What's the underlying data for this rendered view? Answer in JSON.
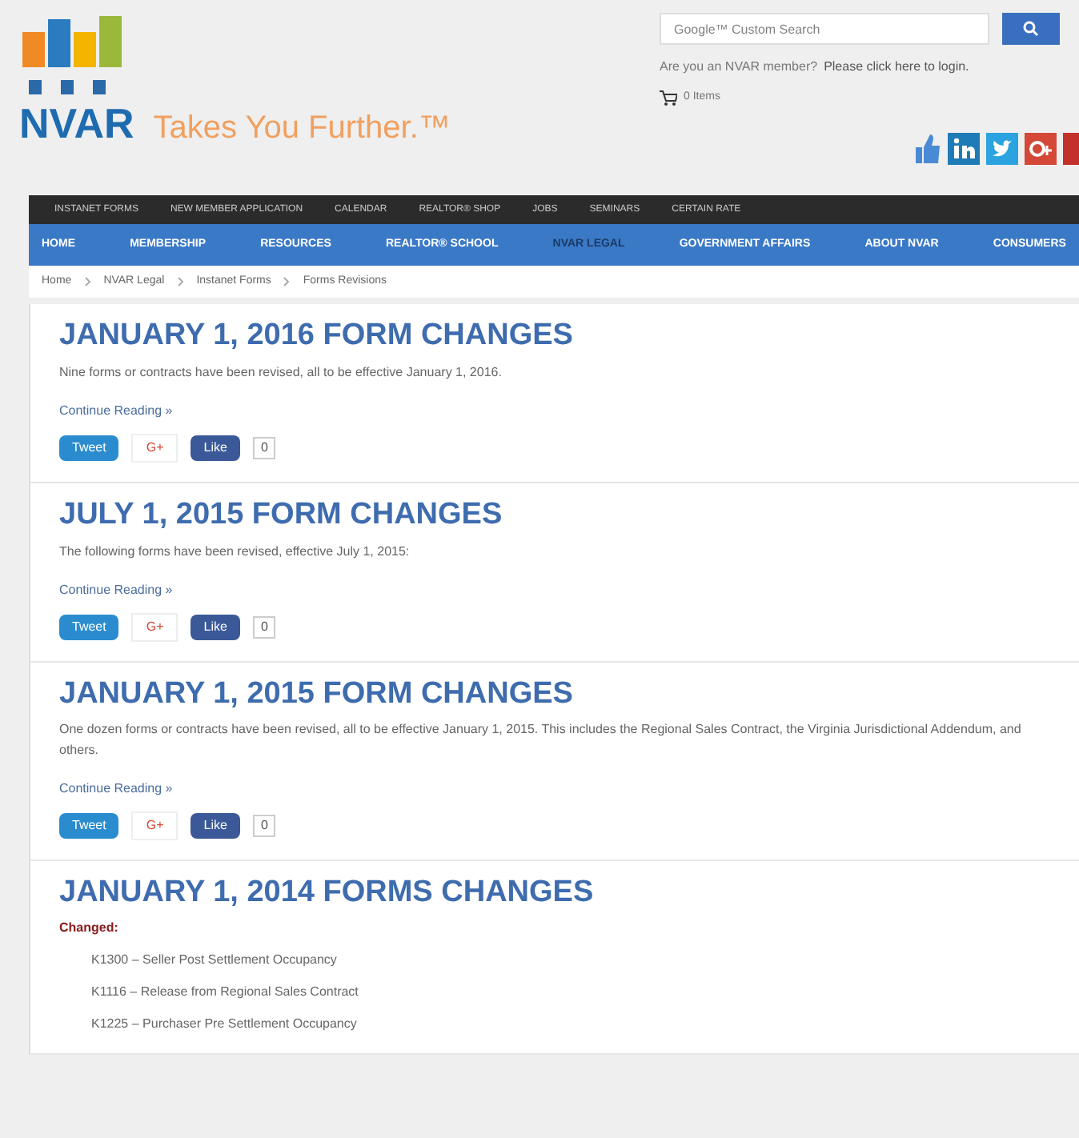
{
  "header": {
    "logo_mark": "NVAR",
    "tagline": "Takes You Further.™",
    "search": {
      "placeholder": "Google™ Custom Search"
    },
    "login_prompt": "Are you an NVAR member?",
    "login_link": "Please click here to login.",
    "cart": "0 Items"
  },
  "top_nav": [
    "INSTANET FORMS",
    "NEW MEMBER APPLICATION",
    "CALENDAR",
    "REALTOR® SHOP",
    "JOBS",
    "SEMINARS",
    "CERTAIN RATE"
  ],
  "main_nav": [
    {
      "label": "HOME",
      "selected": false
    },
    {
      "label": "MEMBERSHIP",
      "selected": false
    },
    {
      "label": "RESOURCES",
      "selected": false
    },
    {
      "label": "REALTOR® SCHOOL",
      "selected": false
    },
    {
      "label": "NVAR LEGAL",
      "selected": true
    },
    {
      "label": "GOVERNMENT AFFAIRS",
      "selected": false
    },
    {
      "label": "ABOUT NVAR",
      "selected": false
    },
    {
      "label": "CONSUMERS",
      "selected": false
    }
  ],
  "breadcrumb": [
    "Home",
    "NVAR Legal",
    "Instanet Forms",
    "Forms Revisions"
  ],
  "posts": [
    {
      "kind": "teaser",
      "title": "JANUARY 1, 2016 FORM CHANGES",
      "summary": "Nine forms or contracts have been revised, all to be effective January 1, 2016.",
      "more": "Continue Reading »",
      "share": {
        "tweet": "Tweet",
        "plus": "G+",
        "like": "Like",
        "count": "0"
      }
    },
    {
      "kind": "teaser",
      "title": "JULY 1, 2015 FORM CHANGES",
      "summary": "The following forms have been revised, effective July 1, 2015:",
      "more": "Continue Reading »",
      "share": {
        "tweet": "Tweet",
        "plus": "G+",
        "like": "Like",
        "count": "0"
      }
    },
    {
      "kind": "teaser",
      "title": "JANUARY 1, 2015 FORM CHANGES",
      "summary": "One dozen forms or contracts have been revised, all to be effective January 1, 2015. This includes the Regional Sales Contract, the Virginia Jurisdictional Addendum, and others.",
      "more": "Continue Reading »",
      "share": {
        "tweet": "Tweet",
        "plus": "G+",
        "like": "Like",
        "count": "0"
      }
    },
    {
      "kind": "list",
      "title": "JANUARY 1, 2014 FORMS CHANGES",
      "label": "Changed:",
      "items": [
        "K1300 – Seller Post Settlement Occupancy",
        "K1116 – Release from Regional Sales Contract",
        "K1225 – Purchaser Pre Settlement Occupancy"
      ]
    }
  ]
}
